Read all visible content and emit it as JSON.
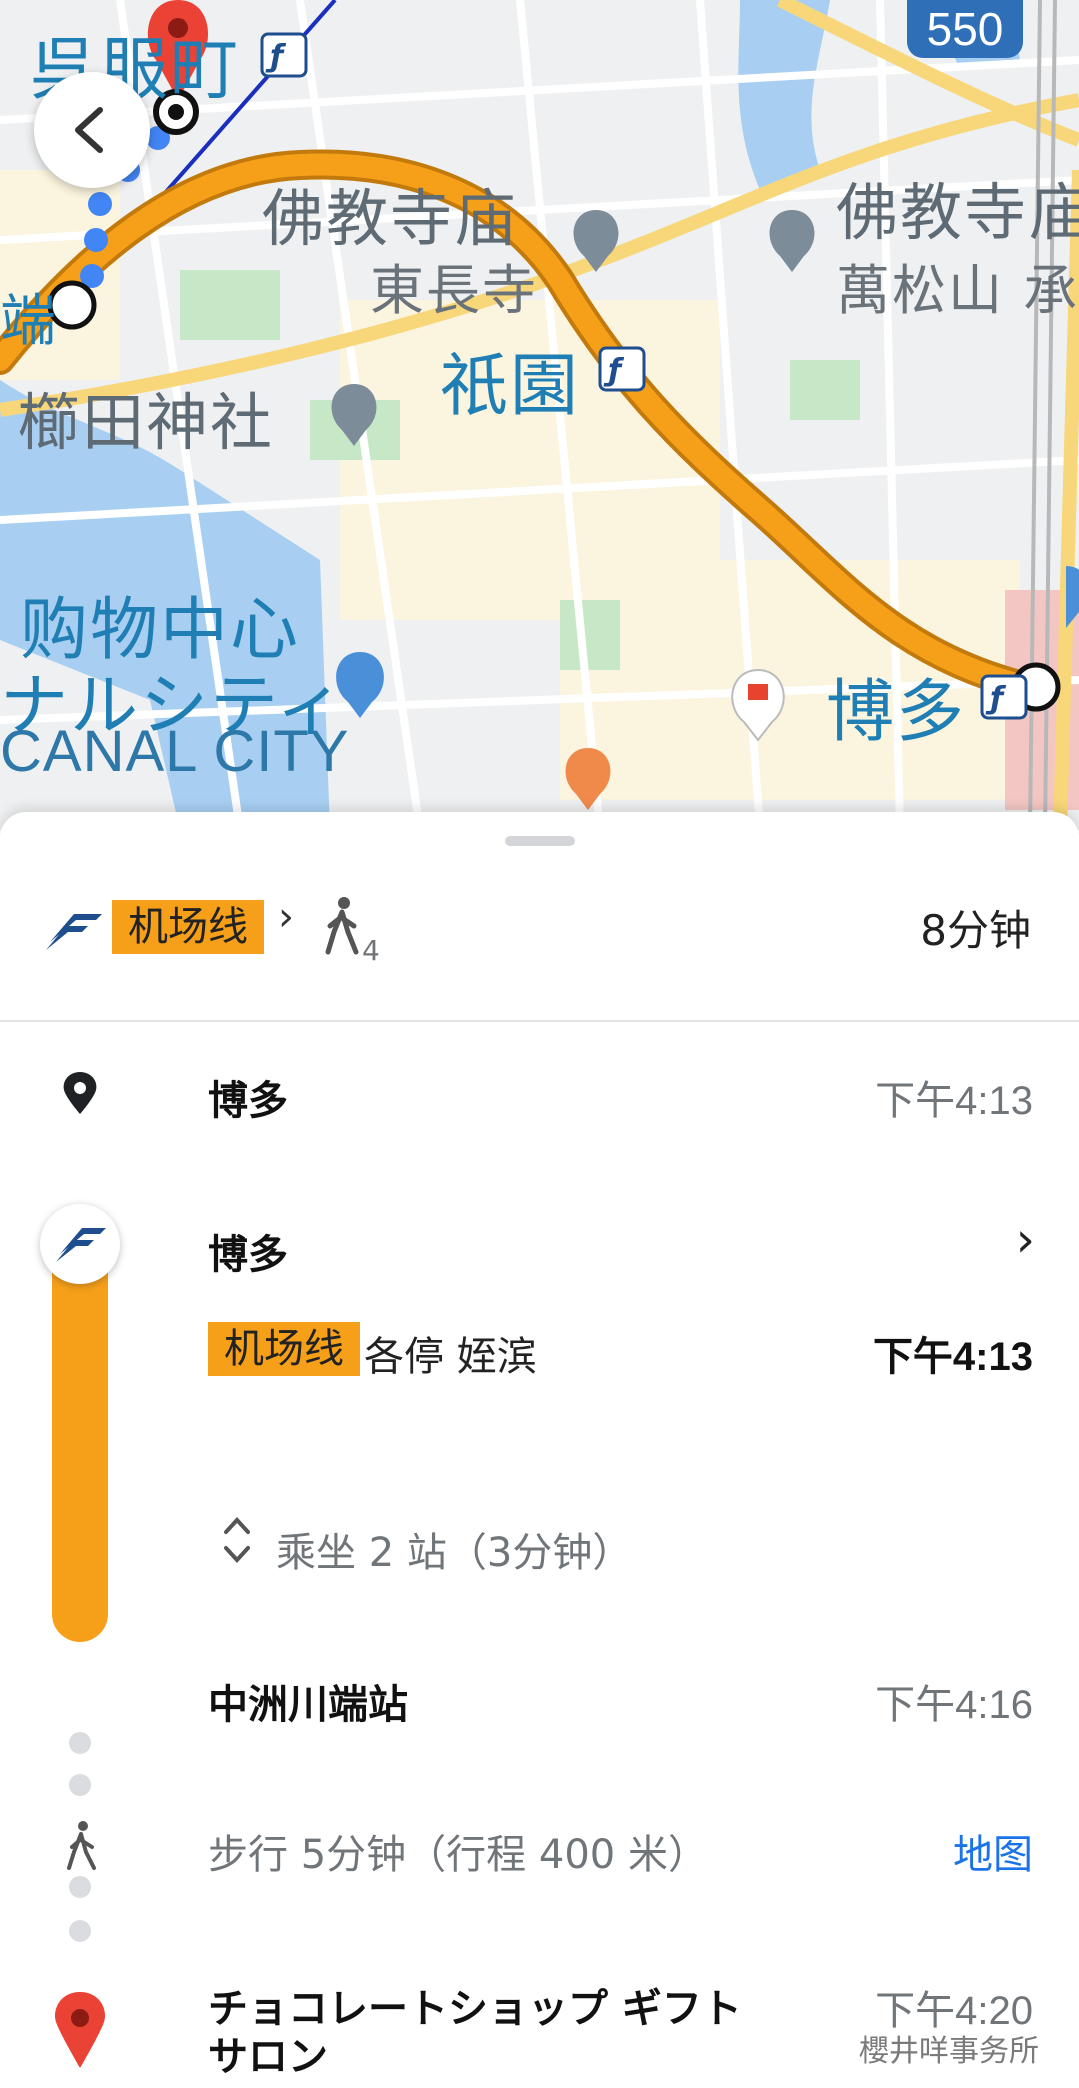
{
  "map": {
    "labels": {
      "gofukumachi": "呉服町",
      "buddhist_temple_1": "佛教寺庙",
      "tochoji": "東長寺",
      "buddhist_temple_2": "佛教寺庙",
      "manshozan": "萬松山 承",
      "gion": "祇園",
      "kushida": "櫛田神社",
      "shopping_center": "购物中心",
      "canal_katakana": "ナルシティ",
      "canal_city": "CANAL CITY",
      "hakata": "博多",
      "edge_fragment": "端"
    },
    "route_shield": "550",
    "colors": {
      "route": "#f6a01a",
      "route_outline": "#c37a0c",
      "walk_dots": "#4285f4",
      "pin": "#ea4335"
    }
  },
  "summary": {
    "line_name": "机场线",
    "walk_minutes": "4",
    "duration": "8分钟"
  },
  "itinerary": {
    "start": {
      "name": "博多",
      "time": "下午4:13"
    },
    "board": {
      "station": "博多",
      "line_name": "机场线",
      "direction": "各停 姪滨",
      "time": "下午4:13",
      "ride_info": "乘坐 2 站（3分钟）"
    },
    "alight": {
      "station": "中洲川端站",
      "time": "下午4:16"
    },
    "walk": {
      "text": "步行 5分钟（行程 400 米）",
      "map_link": "地图"
    },
    "destination": {
      "name_line1": "チョコレートショップ ギフト",
      "name_line2": "サロン",
      "time": "下午4:20"
    }
  },
  "watermark": "櫻井咩事务所"
}
